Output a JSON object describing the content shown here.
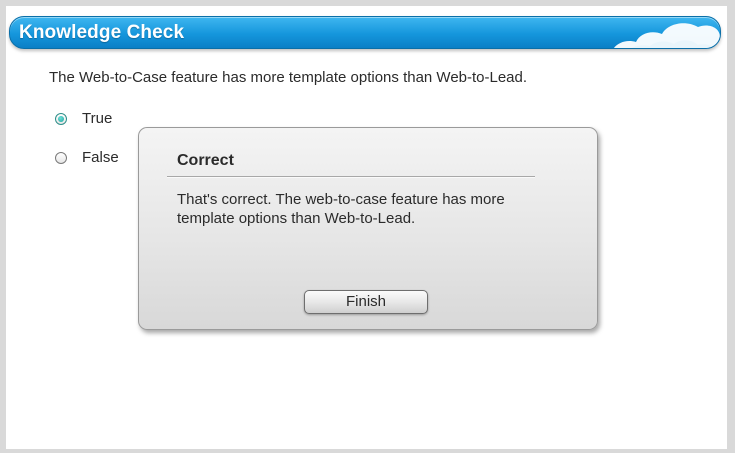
{
  "header": {
    "title": "Knowledge Check"
  },
  "question": {
    "text": "The Web-to-Case feature has more template options than Web-to-Lead.",
    "options": [
      {
        "label": "True",
        "selected": true
      },
      {
        "label": "False",
        "selected": false
      }
    ]
  },
  "feedback_dialog": {
    "title": "Correct",
    "message": "That's correct. The web-to-case feature has more template options than Web-to-Lead.",
    "button_label": "Finish"
  },
  "colors": {
    "header_blue": "#1596dc",
    "radio_selected": "#1aa49c",
    "background": "#d9d9d9"
  },
  "icons": {
    "header_decoration": "cloud-icon"
  }
}
